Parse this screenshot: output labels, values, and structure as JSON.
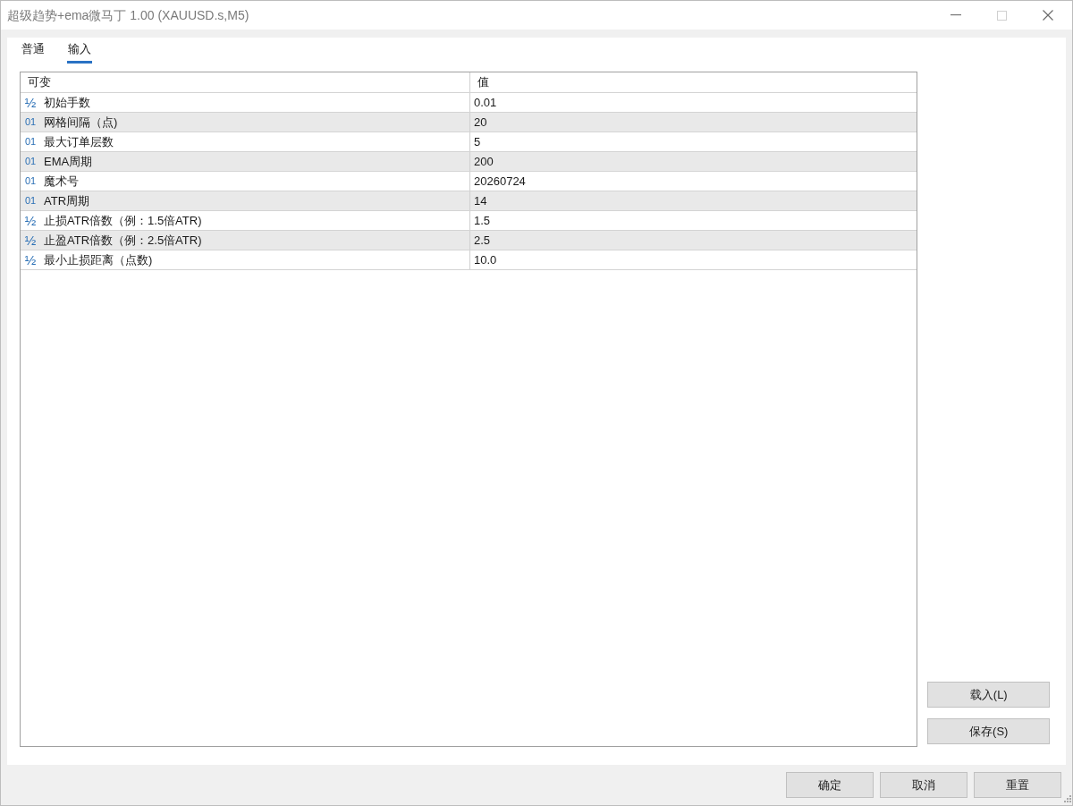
{
  "window": {
    "title": "超级趋势+ema微马丁 1.00 (XAUUSD.s,M5)"
  },
  "tabs": [
    {
      "label": "普通",
      "selected": false
    },
    {
      "label": "输入",
      "selected": true
    }
  ],
  "table": {
    "columns": [
      "可变",
      "值"
    ],
    "rows": [
      {
        "kind": "double",
        "icon": "½",
        "name": "初始手数",
        "value": "0.01"
      },
      {
        "kind": "int",
        "icon": "01",
        "name": "网格间隔（点)",
        "value": "20"
      },
      {
        "kind": "int",
        "icon": "01",
        "name": "最大订单层数",
        "value": "5"
      },
      {
        "kind": "int",
        "icon": "01",
        "name": "EMA周期",
        "value": "200"
      },
      {
        "kind": "int",
        "icon": "01",
        "name": "魔术号",
        "value": "20260724"
      },
      {
        "kind": "int",
        "icon": "01",
        "name": "ATR周期",
        "value": "14"
      },
      {
        "kind": "double",
        "icon": "½",
        "name": "止损ATR倍数（例：1.5倍ATR)",
        "value": "1.5"
      },
      {
        "kind": "double",
        "icon": "½",
        "name": "止盈ATR倍数（例：2.5倍ATR)",
        "value": "2.5"
      },
      {
        "kind": "double",
        "icon": "½",
        "name": "最小止损距离（点数)",
        "value": "10.0"
      }
    ]
  },
  "side_buttons": [
    "载入(L)",
    "保存(S)"
  ],
  "dialog_buttons": [
    "确定",
    "取消",
    "重置"
  ]
}
